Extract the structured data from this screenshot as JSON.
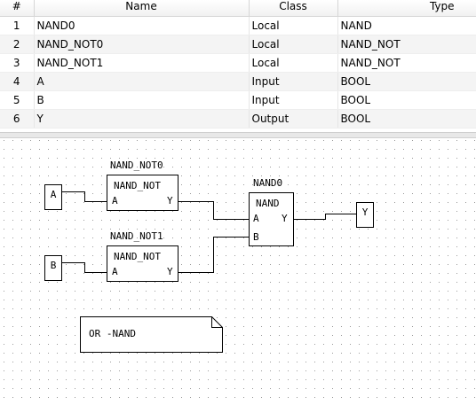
{
  "variables": {
    "headers": {
      "index": "#",
      "name": "Name",
      "class": "Class",
      "type": "Type"
    },
    "rows": [
      {
        "index": "1",
        "name": "NAND0",
        "class": "Local",
        "type": "NAND"
      },
      {
        "index": "2",
        "name": "NAND_NOT0",
        "class": "Local",
        "type": "NAND_NOT"
      },
      {
        "index": "3",
        "name": "NAND_NOT1",
        "class": "Local",
        "type": "NAND_NOT"
      },
      {
        "index": "4",
        "name": "A",
        "class": "Input",
        "type": "BOOL"
      },
      {
        "index": "5",
        "name": "B",
        "class": "Input",
        "type": "BOOL"
      },
      {
        "index": "6",
        "name": "Y",
        "class": "Output",
        "type": "BOOL"
      }
    ]
  },
  "diagram": {
    "input_a": "A",
    "input_b": "B",
    "output_y": "Y",
    "nand_not0": {
      "instance": "NAND_NOT0",
      "type": "NAND_NOT",
      "pin_in": "A",
      "pin_out": "Y"
    },
    "nand_not1": {
      "instance": "NAND_NOT1",
      "type": "NAND_NOT",
      "pin_in": "A",
      "pin_out": "Y"
    },
    "nand0": {
      "instance": "NAND0",
      "type": "NAND",
      "pin_a": "A",
      "pin_b": "B",
      "pin_out": "Y"
    },
    "comment": "OR -NAND"
  }
}
